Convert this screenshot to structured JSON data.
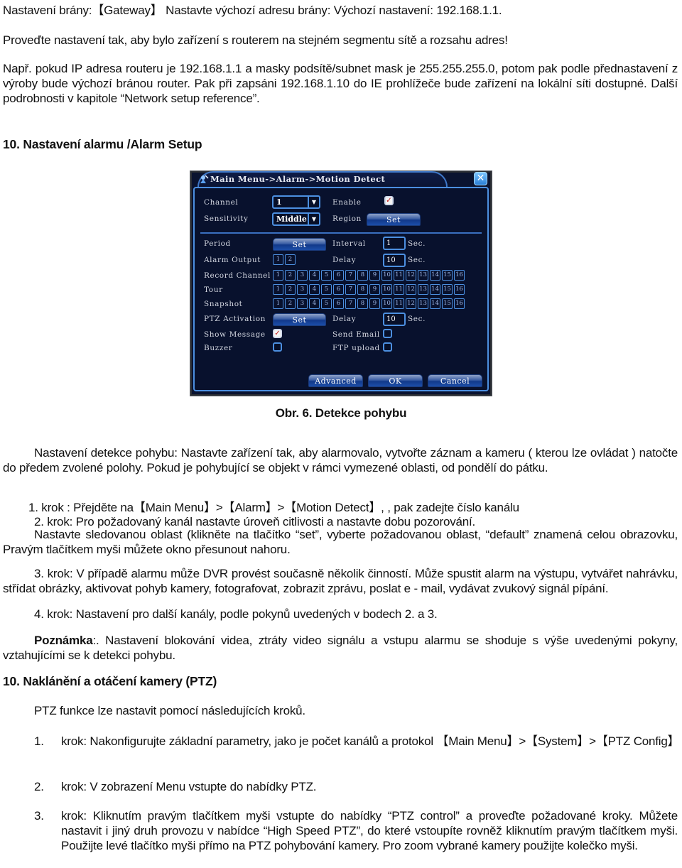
{
  "intro": {
    "gateway_line": "Nastavení brány:【Gateway】 Nastavte výchozí adresu brány: Výchozí nastavení: 192.168.1.1.",
    "segment_line": "Proveďte nastavení tak, aby bylo zařízení s routerem na stejném segmentu sítě a rozsahu adres!",
    "example_paragraph": "Např. pokud IP adresa routeru je 192.168.1.1 a masky podsítě/subnet mask je 255.255.255.0, potom pak podle přednastavení z výroby bude výchozí bránou router.  Pak při zapsáni 192.168.1.10 do IE prohlížeče bude zařízení na lokální síti dostupné. Další podrobnosti v kapitole “Network setup reference”."
  },
  "section_alarm": {
    "heading": "10. Nastavení alarmu /Alarm Setup"
  },
  "dialog": {
    "title": "Main Menu->Alarm->Motion Detect",
    "close_label": "✕",
    "channel_label": "Channel",
    "channel_value": "1",
    "enable_label": "Enable",
    "enable_checked": true,
    "sensitivity_label": "Sensitivity",
    "sensitivity_value": "Middle",
    "region_label": "Region",
    "set_label": "Set",
    "period_label": "Period",
    "interval_label": "Interval",
    "interval_value": "1",
    "sec_label": "Sec.",
    "alarm_output_label": "Alarm Output",
    "alarm_outputs": [
      "1",
      "2"
    ],
    "delay_label": "Delay",
    "delay_value": "10",
    "record_channel_label": "Record Channel",
    "tour_label": "Tour",
    "snapshot_label": "Snapshot",
    "channels": [
      "1",
      "2",
      "3",
      "4",
      "5",
      "6",
      "7",
      "8",
      "9",
      "10",
      "11",
      "12",
      "13",
      "14",
      "15",
      "16"
    ],
    "ptz_activation_label": "PTZ Activation",
    "ptz_delay_label": "Delay",
    "ptz_delay_value": "10",
    "show_message_label": "Show Message",
    "show_message_checked": true,
    "send_email_label": "Send Email",
    "send_email_checked": false,
    "buzzer_label": "Buzzer",
    "buzzer_checked": false,
    "ftp_upload_label": "FTP upload",
    "ftp_upload_checked": false,
    "advanced_label": "Advanced",
    "ok_label": "OK",
    "cancel_label": "Cancel"
  },
  "caption": "Obr. 6. Detekce pohybu",
  "motion": {
    "intro": "Nastavení detekce pohybu: Nastavte zařízení tak, aby alarmovalo, vytvořte záznam a kameru ( kterou lze ovládat ) natočte do předem zvolené polohy. Pokud je pohybující se objekt v rámci vymezené oblasti, od pondělí do pátku.",
    "step1": "1. krok : Přejděte na【Main Menu】>【Alarm】>【Motion Detect】, , pak zadejte číslo kanálu",
    "step2": "2. krok: Pro požadovaný kanál nastavte úroveň citlivosti a nastavte dobu pozorování.",
    "step2b": "Nastavte sledovanou oblast (klikněte na tlačítko “set”, vyberte požadovanou oblast,  “default” znamená celou obrazovku, Pravým tlačítkem myši můžete okno přesunout nahoru.",
    "step3": "3. krok: V případě alarmu může DVR provést současně několik činností. Může spustit alarm na výstupu, vytvářet nahrávku, střídat obrázky, aktivovat pohyb kamery, fotografovat, zobrazit zprávu, poslat e - mail, vydávat zvukový signál pípání.",
    "step4": "4. krok: Nastavení pro další kanály, podle pokynů uvedených v bodech 2. a 3.",
    "note_label": "Poznámka",
    "note_text": ":. Nastavení blokování videa, ztráty video signálu a vstupu alarmu se shoduje s výše uvedenými pokyny, vztahujícími se k detekci pohybu."
  },
  "section_ptz": {
    "heading": "10. Naklánění a otáčení kamery (PTZ)",
    "intro": "PTZ funkce lze nastavit pomocí následujících kroků.",
    "steps": [
      {
        "num": "1.",
        "text": "krok:  Nakonfigurujte  základní  parametry,  jako  je  počet  kanálů  a  protokol  【Main Menu】>【System】>【PTZ Config】"
      },
      {
        "num": "2.",
        "text": "krok:  V zobrazení Menu vstupte do nabídky PTZ."
      },
      {
        "num": "3.",
        "text": "krok: Kliknutím pravým tlačítkem myši vstupte do nabídky “PTZ control” a proveďte požadované kroky. Můžete nastavit i jiný druh provozu v nabídce “High Speed PTZ”, do které vstoupíte rovněž kliknutím pravým tlačítkem myši. Použijte levé tlačítko myši přímo na PTZ pohybování kamery. Pro zoom vybrané kamery použijte kolečko myši."
      }
    ]
  }
}
